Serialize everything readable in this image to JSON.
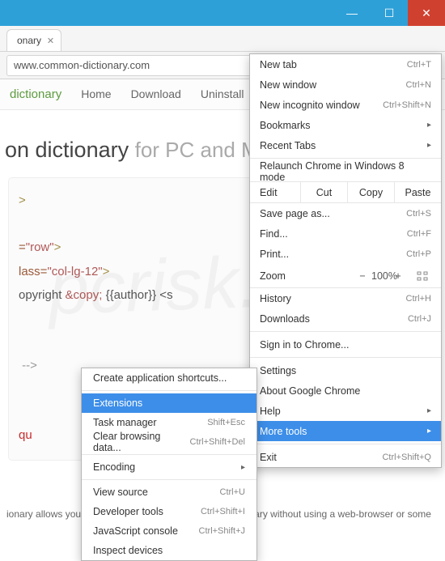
{
  "window": {
    "min_icon": "—",
    "max_icon": "☐",
    "close_icon": "✕"
  },
  "tab": {
    "title": "onary",
    "close": "✕"
  },
  "url": "www.common-dictionary.com",
  "star": "☆",
  "menu_button_icon": "≡",
  "site_nav": {
    "brand": "dictionary",
    "items": [
      "Home",
      "Download",
      "Uninstall"
    ]
  },
  "hero": {
    "main": "on dictionary",
    "sub": "for PC and Mac"
  },
  "code": {
    "l1": ">",
    "l2a": "=",
    "l2b": "\"row\"",
    "l2c": ">",
    "l3a": "lass=",
    "l3b": "\"col-lg-12\"",
    "l3c": ">",
    "l4a": "opyright ",
    "l4amp": "&copy;",
    "l4b": " {{author}} <s",
    "l5": " -->",
    "l6": "qu"
  },
  "watermark": "pcrisk.com",
  "footer": "ionary allows you to lookup words from the english dictionary without using a web-browser or some",
  "menu": {
    "new_tab": {
      "label": "New tab",
      "sc": "Ctrl+T"
    },
    "new_window": {
      "label": "New window",
      "sc": "Ctrl+N"
    },
    "incognito": {
      "label": "New incognito window",
      "sc": "Ctrl+Shift+N"
    },
    "bookmarks": {
      "label": "Bookmarks"
    },
    "recent": {
      "label": "Recent Tabs"
    },
    "relaunch": {
      "label": "Relaunch Chrome in Windows 8 mode"
    },
    "edit": {
      "label": "Edit",
      "cut": "Cut",
      "copy": "Copy",
      "paste": "Paste"
    },
    "save": {
      "label": "Save page as...",
      "sc": "Ctrl+S"
    },
    "find": {
      "label": "Find...",
      "sc": "Ctrl+F"
    },
    "print": {
      "label": "Print...",
      "sc": "Ctrl+P"
    },
    "zoom": {
      "label": "Zoom",
      "minus": "−",
      "value": "100%",
      "plus": "+"
    },
    "history": {
      "label": "History",
      "sc": "Ctrl+H"
    },
    "downloads": {
      "label": "Downloads",
      "sc": "Ctrl+J"
    },
    "signin": {
      "label": "Sign in to Chrome..."
    },
    "settings": {
      "label": "Settings"
    },
    "about": {
      "label": "About Google Chrome"
    },
    "help": {
      "label": "Help"
    },
    "more_tools": {
      "label": "More tools"
    },
    "exit": {
      "label": "Exit",
      "sc": "Ctrl+Shift+Q"
    }
  },
  "submenu": {
    "create_shortcut": {
      "label": "Create application shortcuts..."
    },
    "extensions": {
      "label": "Extensions"
    },
    "task_manager": {
      "label": "Task manager",
      "sc": "Shift+Esc"
    },
    "clear_data": {
      "label": "Clear browsing data...",
      "sc": "Ctrl+Shift+Del"
    },
    "encoding": {
      "label": "Encoding"
    },
    "view_source": {
      "label": "View source",
      "sc": "Ctrl+U"
    },
    "dev_tools": {
      "label": "Developer tools",
      "sc": "Ctrl+Shift+I"
    },
    "js_console": {
      "label": "JavaScript console",
      "sc": "Ctrl+Shift+J"
    },
    "inspect": {
      "label": "Inspect devices"
    }
  }
}
